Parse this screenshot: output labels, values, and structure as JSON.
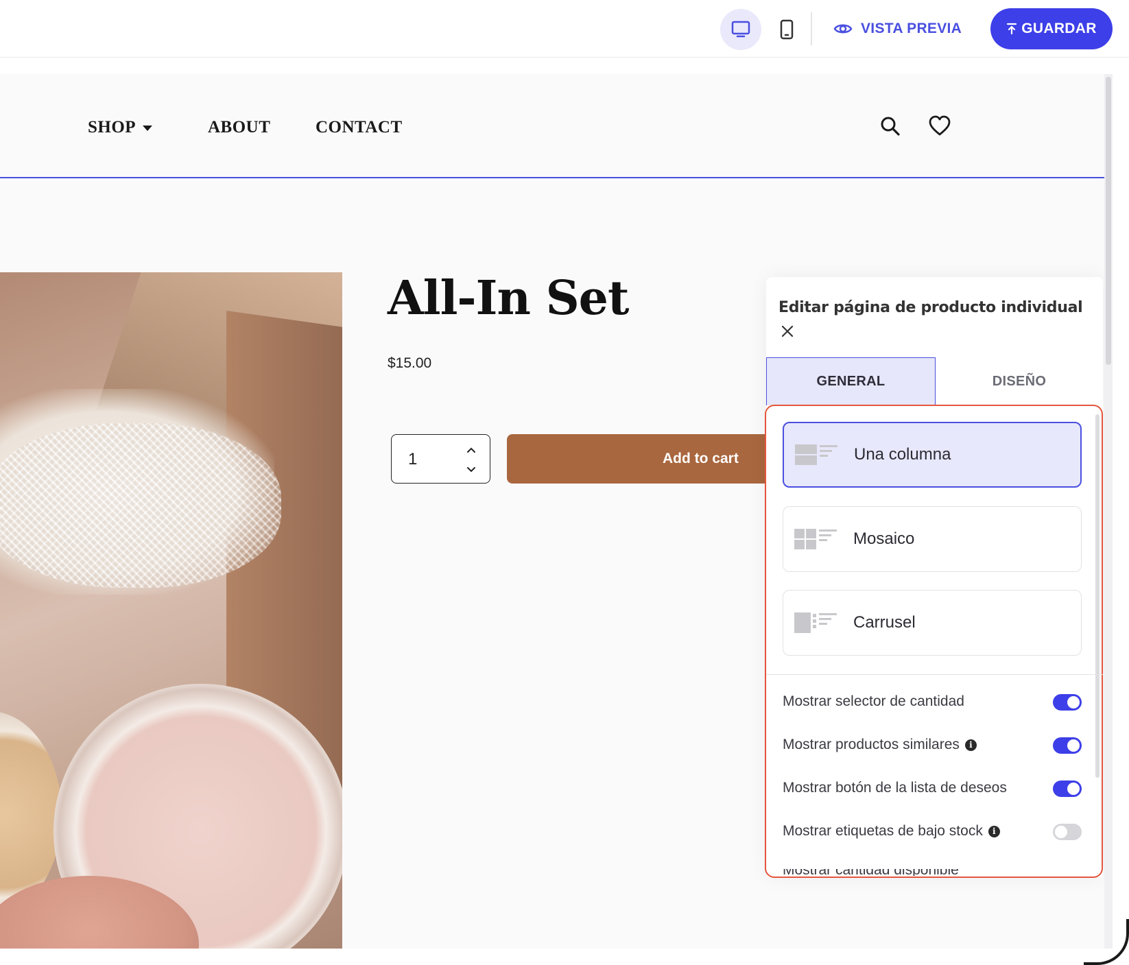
{
  "toolbar": {
    "preview_label": "VISTA PREVIA",
    "save_label": "GUARDAR"
  },
  "store": {
    "nav": {
      "shop": "SHOP",
      "about": "ABOUT",
      "contact": "CONTACT"
    },
    "product": {
      "title": "All-In Set",
      "price": "$15.00",
      "quantity": "1",
      "add_to_cart": "Add to cart"
    }
  },
  "panel": {
    "title": "Editar página de producto individual",
    "tabs": {
      "general": "GENERAL",
      "design": "DISEÑO"
    },
    "layouts": [
      {
        "label": "Una columna",
        "selected": true
      },
      {
        "label": "Mosaico",
        "selected": false
      },
      {
        "label": "Carrusel",
        "selected": false
      }
    ],
    "toggles": [
      {
        "label": "Mostrar selector de cantidad",
        "info": false,
        "on": true
      },
      {
        "label": "Mostrar productos similares",
        "info": true,
        "on": true
      },
      {
        "label": "Mostrar botón de la lista de deseos",
        "info": false,
        "on": true
      },
      {
        "label": "Mostrar etiquetas de bajo stock",
        "info": true,
        "on": false
      }
    ],
    "cut_off_label": "Mostrar cantidad disponible"
  },
  "colors": {
    "accent": "#3d3fe8",
    "cart_button": "#a9673f",
    "highlight_outline": "#e5553c"
  }
}
